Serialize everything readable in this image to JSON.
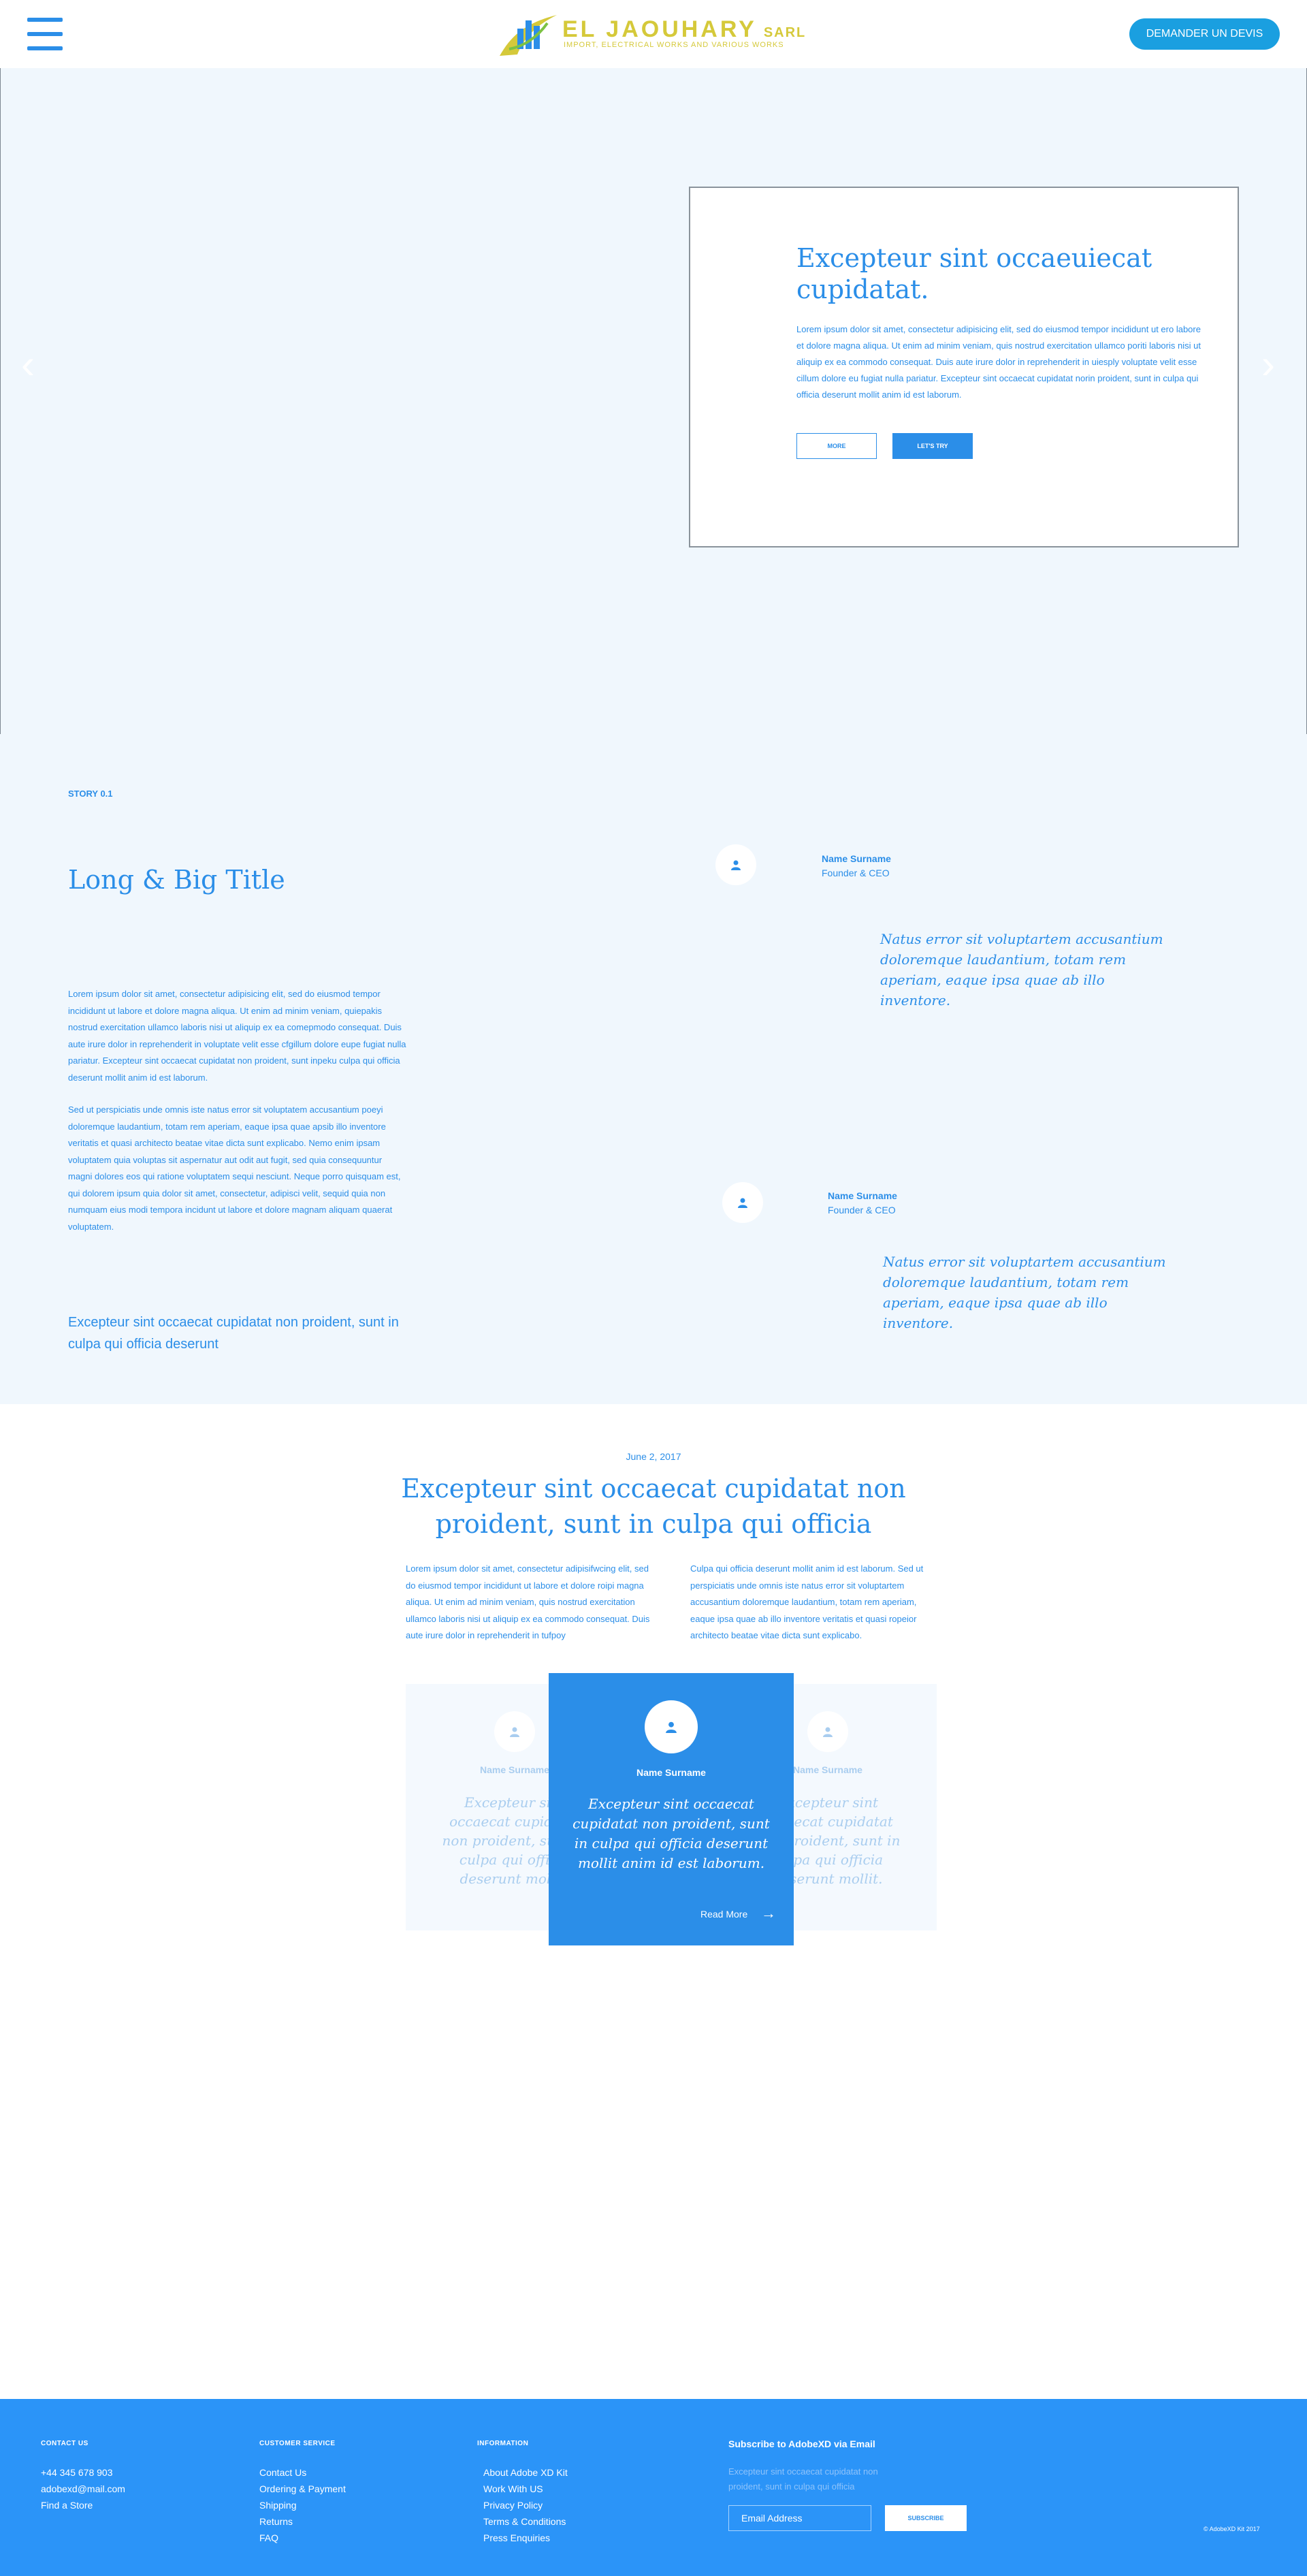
{
  "header": {
    "logo_name": "EL JAOUHARY",
    "logo_suffix": "SARL",
    "logo_tagline": "IMPORT, ELECTRICAL WORKS AND VARIOUS WORKS",
    "cta_label": "DEMANDER UN DEVIS"
  },
  "hero": {
    "title": "Excepteur sint occaeuiecat cupidatat.",
    "body": "Lorem ipsum dolor sit amet, consectetur adipisicing elit, sed do eiusmod tempor incididunt ut ero labore et dolore magna aliqua. Ut enim ad minim veniam, quis nostrud exercitation ullamco poriti laboris nisi ut aliquip ex ea commodo consequat. Duis aute irure dolor in reprehenderit in uiesply voluptate velit esse cillum dolore eu fugiat nulla pariatur. Excepteur sint occaecat cupidatat norin proident, sunt in culpa qui officia deserunt mollit anim id est laborum.",
    "more_label": "MORE",
    "try_label": "LET'S TRY",
    "prev_arrow": "‹",
    "next_arrow": "›"
  },
  "story": {
    "tag": "STORY 0.1",
    "title": "Long & Big Title",
    "paragraph_1": "Lorem ipsum dolor sit amet, consectetur adipisicing elit, sed do eiusmod tempor incididunt ut labore et dolore magna aliqua. Ut enim ad minim veniam, quiepakis nostrud exercitation ullamco laboris nisi ut aliquip ex ea comepmodo consequat. Duis aute irure dolor in reprehenderit in voluptate velit esse cfgillum dolore eupe fugiat nulla pariatur. Excepteur sint occaecat cupidatat non proident, sunt inpeku culpa qui officia deserunt mollit anim id est laborum.",
    "paragraph_2": "Sed ut perspiciatis unde omnis iste natus error sit voluptatem accusantium poeyi doloremque laudantium, totam rem aperiam, eaque ipsa quae apsib illo inventore veritatis et quasi architecto beatae vitae dicta sunt explicabo. Nemo enim ipsam voluptatem quia voluptas sit aspernatur aut odit aut fugit, sed quia consequuntur magni dolores eos qui ratione voluptatem sequi nesciunt. Neque porro quisquam est, qui dolorem ipsum quia dolor sit amet, consectetur, adipisci velit, sequid quia non numquam eius modi tempora incidunt ut labore et dolore magnam aliquam quaerat voluptatem.",
    "quote": "Excepteur sint occaecat cupidatat non proident, sunt in culpa qui officia deserunt",
    "testimonials": [
      {
        "name": "Name Surname",
        "role": "Founder & CEO",
        "quote": "Natus error sit voluptartem accusantium doloremque laudantium, totam rem aperiam, eaque ipsa quae ab illo inventore."
      },
      {
        "name": "Name Surname",
        "role": "Founder & CEO",
        "quote": "Natus error sit voluptartem accusantium doloremque laudantium, totam rem aperiam, eaque ipsa quae ab illo inventore."
      }
    ]
  },
  "article": {
    "date": "June 2, 2017",
    "title": "Excepteur sint occaecat cupidatat non proident, sunt in culpa qui officia",
    "col_left": "Lorem ipsum dolor sit amet, consectetur adipisifwcing elit, sed do eiusmod tempor incididunt ut labore et dolore roipi magna aliqua. Ut enim ad minim veniam, quis nostrud exercitation ullamco laboris nisi ut aliquip ex ea commodo consequat. Duis aute irure dolor in reprehenderit in tufpoy",
    "col_right": "Culpa qui officia deserunt mollit anim id est laborum. Sed ut perspiciatis unde omnis iste natus error sit voluptartem accusantium doloremque laudantium, totam rem aperiam, eaque ipsa quae ab illo inventore veritatis et quasi ropeior architecto beatae vitae dicta sunt explicabo."
  },
  "carousel": {
    "left": {
      "name": "Name Surname",
      "quote": "Excepteur sint occaecat cupidatat non proident, sunt in culpa qui officia deserunt mollit."
    },
    "main": {
      "name": "Name Surname",
      "quote": "Excepteur sint occaecat cupidatat non proident, sunt in culpa qui officia deserunt mollit anim id est laborum.",
      "read_more": "Read More",
      "arrow": "→"
    },
    "right": {
      "name": "Name Surname",
      "quote": "Excepteur sint occaecat cupidatat non proident, sunt in culpa qui officia deserunt mollit."
    }
  },
  "footer": {
    "contact": {
      "heading": "CONTACT US",
      "items": [
        "+44 345 678 903",
        "adobexd@mail.com",
        "Find a Store"
      ]
    },
    "customer_service": {
      "heading": "CUSTOMER SERVICE",
      "items": [
        "Contact Us",
        "Ordering & Payment",
        "Shipping",
        "Returns",
        "FAQ"
      ]
    },
    "information": {
      "heading": "INFORMATION",
      "items": [
        "About Adobe XD Kit",
        "Work With US",
        "Privacy Policy",
        "Terms & Conditions",
        "Press Enquiries"
      ]
    },
    "subscribe": {
      "heading": "Subscribe to AdobeXD via Email",
      "text": "Excepteur sint occaecat cupidatat non proident, sunt in culpa qui officia",
      "placeholder": "Email Address",
      "button": "SUBSCRIBE"
    },
    "copyright": "© AdobeXD Kit 2017"
  },
  "colors": {
    "brand_blue": "#2b8ee8",
    "cta_blue": "#1a9fe0",
    "logo_gold": "#d5c93a",
    "hero_bg": "#f0f7fd",
    "footer_bg": "#2b94f8"
  },
  "icons": {
    "menu": "hamburger-icon",
    "user": "user-icon",
    "arrow": "arrow-right-icon"
  }
}
